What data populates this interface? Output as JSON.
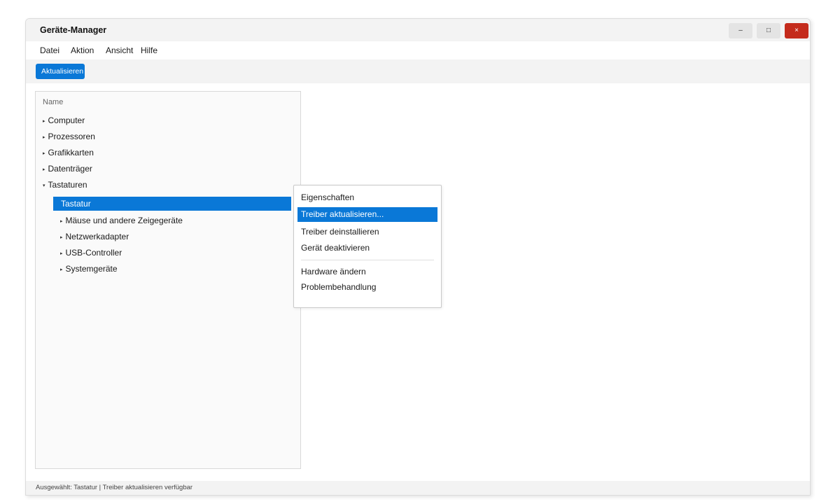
{
  "window": {
    "title": "Geräte-Manager",
    "controls": {
      "minimize": "–",
      "maximize": "□",
      "close": "×"
    }
  },
  "menubar": {
    "items": [
      "Datei",
      "Aktion",
      "Ansicht",
      "Hilfe"
    ]
  },
  "toolbar": {
    "refresh_label": "Aktualisieren"
  },
  "tree": {
    "header": "Name",
    "items": [
      {
        "label": "Computer",
        "expanded": false
      },
      {
        "label": "Prozessoren",
        "expanded": false
      },
      {
        "label": "Grafikkarten",
        "expanded": false
      },
      {
        "label": "Datenträger",
        "expanded": false
      },
      {
        "label": "Tastaturen",
        "expanded": true
      },
      {
        "label": "Tastatur",
        "selected": true
      },
      {
        "label": "Mäuse und andere Zeigegeräte",
        "expanded": false
      },
      {
        "label": "Netzwerkadapter",
        "expanded": false
      },
      {
        "label": "USB-Controller",
        "expanded": false
      },
      {
        "label": "Systemgeräte",
        "expanded": false
      }
    ],
    "collapsed_glyph": "▸",
    "expanded_glyph": "▾"
  },
  "context_menu": {
    "items": [
      "Eigenschaften",
      "Treiber aktualisieren...",
      "Treiber deinstallieren",
      "Gerät deaktivieren",
      "Hardware ändern",
      "Problembehandlung"
    ],
    "highlighted_index": 1
  },
  "statusbar": {
    "text": "Ausgewählt: Tastatur | Treiber aktualisieren verfügbar"
  },
  "colors": {
    "accent": "#0a78d7",
    "close": "#c42b1c",
    "panel_bg": "#fafafa",
    "bar_bg": "#f3f3f3"
  }
}
